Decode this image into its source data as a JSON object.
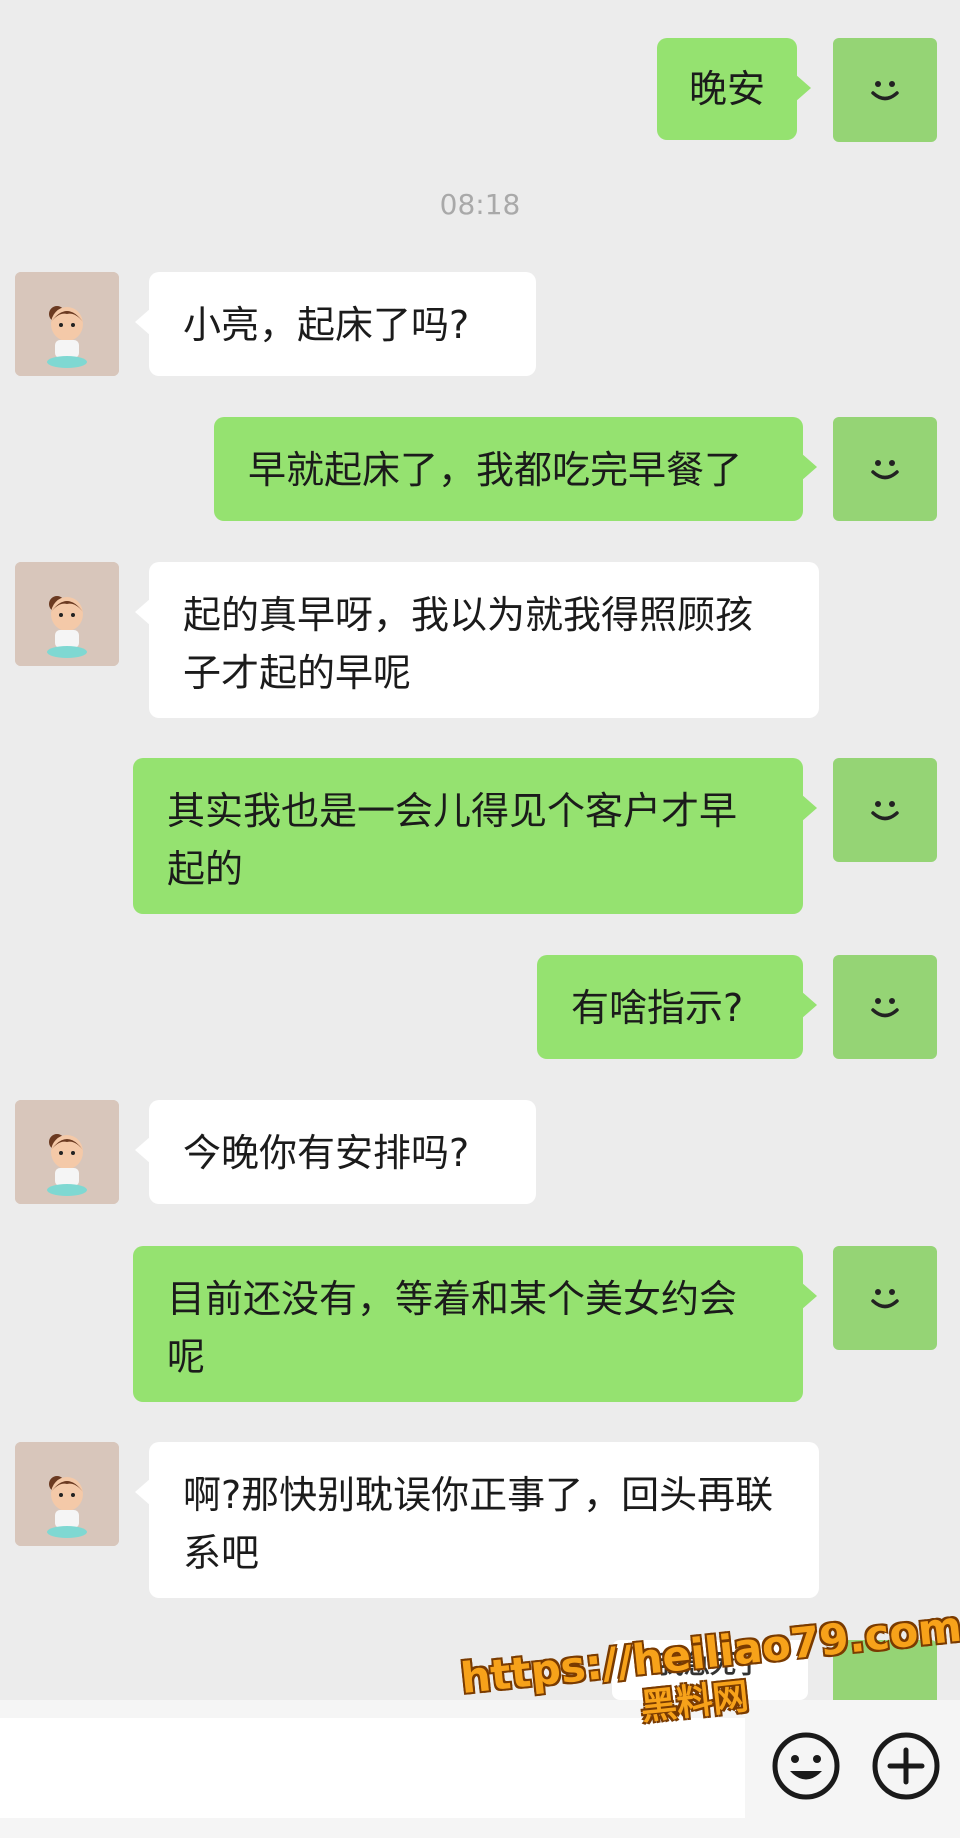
{
  "chat": {
    "timestamp": "08:18",
    "messages": [
      {
        "side": "me",
        "text": "晚安"
      },
      {
        "side": "peer",
        "text": "小亮，起床了吗?"
      },
      {
        "side": "me",
        "text": "早就起床了，我都吃完早餐了"
      },
      {
        "side": "peer",
        "text": "起的真早呀，我以为就我得照顾孩子才起的早呢"
      },
      {
        "side": "me",
        "text": "其实我也是一会儿得见个客户才早起的"
      },
      {
        "side": "me",
        "text": "有啥指示?"
      },
      {
        "side": "peer",
        "text": "今晚你有安排吗?"
      },
      {
        "side": "me",
        "text": "目前还没有，等着和某个美女约会呢"
      },
      {
        "side": "peer",
        "text": "啊?那快别耽误你正事了，回头再联系吧"
      }
    ],
    "partial_message": "我急死了"
  },
  "watermark": {
    "url": "https://heiliao79.com",
    "name": "黑料网"
  },
  "colors": {
    "my_bubble": "#95e270",
    "peer_bubble": "#ffffff",
    "background": "#ececec"
  },
  "icons": {
    "my_avatar": "smiley-face-icon",
    "peer_avatar": "cartoon-girl-avatar",
    "emoji_button": "emoji-icon",
    "more_button": "plus-circle-icon"
  }
}
